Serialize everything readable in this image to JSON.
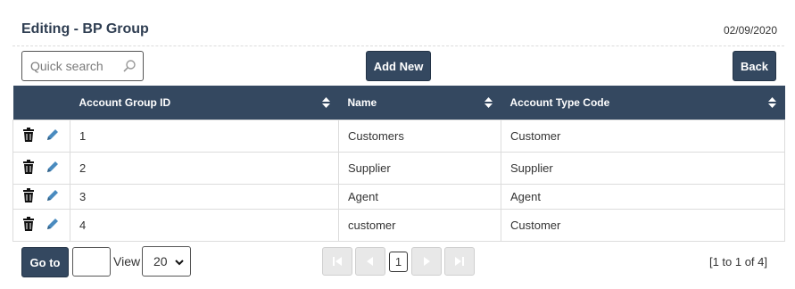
{
  "header": {
    "title": "Editing - BP Group",
    "date": "02/09/2020"
  },
  "toolbar": {
    "search_placeholder": "Quick search",
    "add_new_label": "Add New",
    "back_label": "Back"
  },
  "table": {
    "columns": [
      "Account Group ID",
      "Name",
      "Account Type Code"
    ],
    "rows": [
      {
        "id": "1",
        "name": "Customers",
        "type": "Customer"
      },
      {
        "id": "2",
        "name": "Supplier",
        "type": "Supplier"
      },
      {
        "id": "3",
        "name": "Agent",
        "type": "Agent"
      },
      {
        "id": "4",
        "name": "customer",
        "type": "Customer"
      }
    ]
  },
  "footer": {
    "goto_label": "Go to",
    "view_label": "View",
    "page_size": "20",
    "current_page": "1",
    "page_info": "[1 to 1 of 4]"
  },
  "colors": {
    "header_bg": "#344860",
    "button_bg": "#344860",
    "pencil": "#4a8bbf"
  },
  "icons": [
    "search-icon",
    "sort-icon",
    "trash-icon",
    "pencil-icon",
    "first-page-icon",
    "prev-page-icon",
    "next-page-icon",
    "last-page-icon",
    "chevron-down-icon"
  ]
}
